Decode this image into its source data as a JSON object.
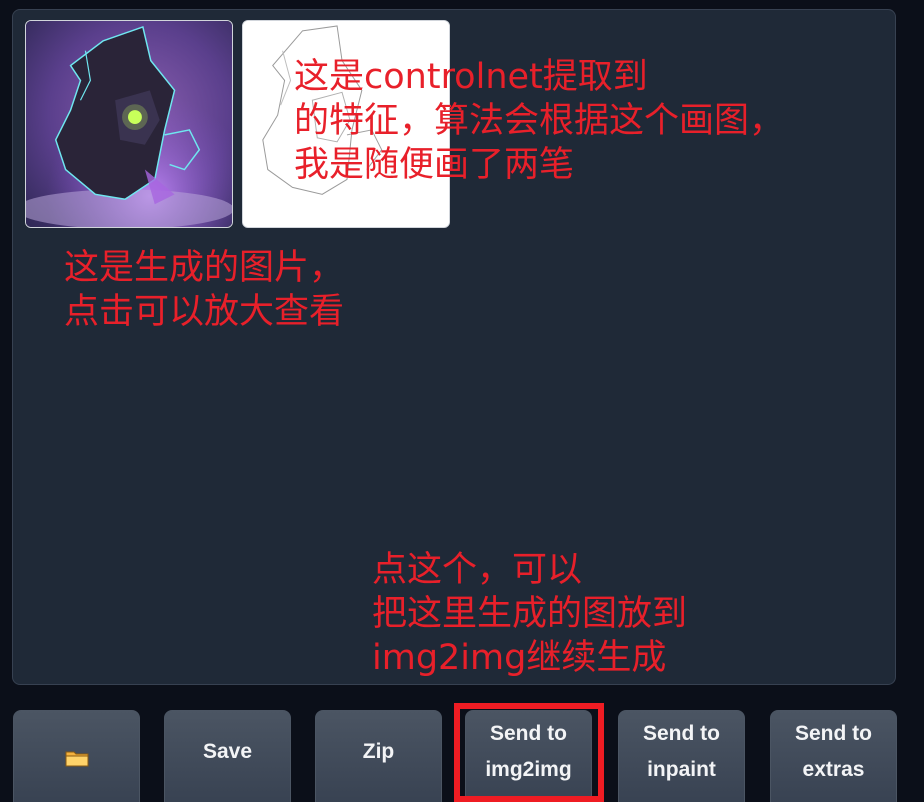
{
  "gallery": {
    "images": [
      {
        "name": "generated-image"
      },
      {
        "name": "controlnet-feature-map"
      }
    ]
  },
  "annotations": {
    "controlnet_note": "这是controlnet提取到\n的特征，算法会根据这个画图，\n我是随便画了两笔",
    "generated_note": "这是生成的图片，\n点击可以放大查看",
    "send_note": "点这个，可以\n把这里生成的图放到\nimg2img继续生成"
  },
  "buttons": {
    "folder_icon": "folder-icon",
    "save_label": "Save",
    "zip_label": "Zip",
    "send_img2img_label": "Send to\nimg2img",
    "send_inpaint_label": "Send to\ninpaint",
    "send_extras_label": "Send to\nextras"
  },
  "colors": {
    "annotation": "#e8202a",
    "highlight": "#ef1c23",
    "background": "#0b0f19",
    "panel": "#1f2937"
  }
}
